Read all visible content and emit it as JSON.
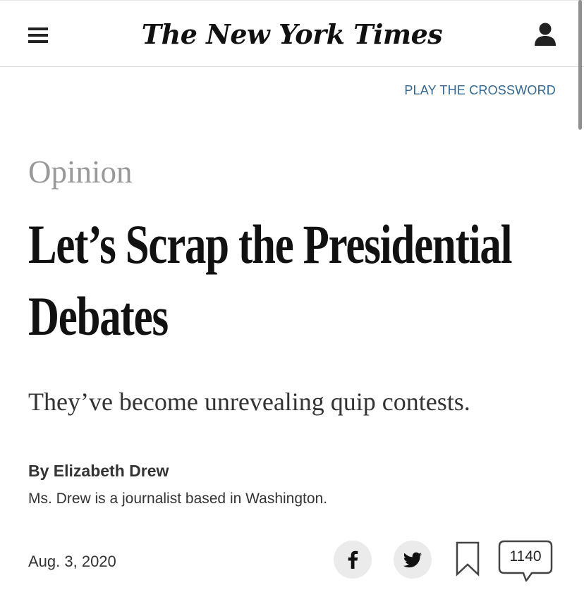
{
  "header": {
    "masthead": "The New York Times",
    "menu_icon": "hamburger-menu-icon",
    "account_icon": "user-account-icon"
  },
  "crossword_link": "PLAY THE CROSSWORD",
  "article": {
    "section": "Opinion",
    "headline": "Let’s Scrap the Presidential Debates",
    "summary": "They’ve become unrevealing quip contests.",
    "byline": "By Elizabeth Drew",
    "author_bio": "Ms. Drew is a journalist based in Washington.",
    "date": "Aug. 3, 2020"
  },
  "share": {
    "facebook_icon": "facebook-icon",
    "twitter_icon": "twitter-icon",
    "bookmark_icon": "bookmark-icon",
    "comments_count": "1140"
  },
  "colors": {
    "link": "#326891",
    "section_label": "#999999",
    "text": "#121212"
  }
}
